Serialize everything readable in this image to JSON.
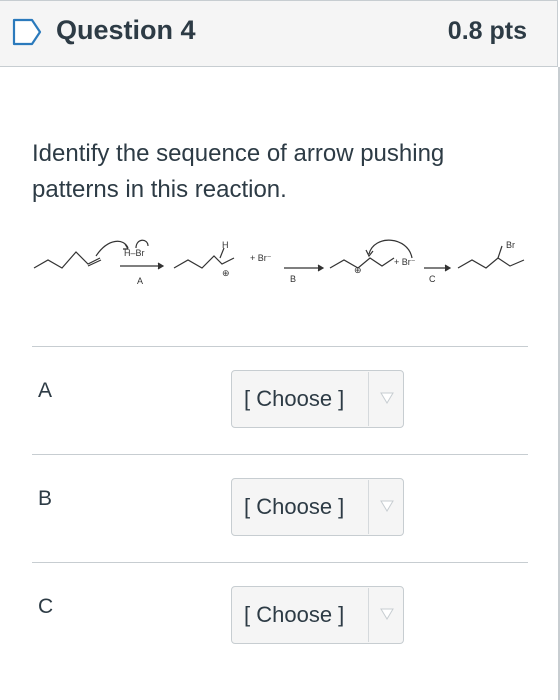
{
  "header": {
    "title": "Question 4",
    "points": "0.8 pts",
    "flag_icon": "bookmark-flag-icon"
  },
  "question": {
    "text": "Identify the sequence of arrow pushing patterns in this reaction."
  },
  "reaction": {
    "reagent": "H–Br",
    "bromide_1": "+ Br⁻",
    "bromide_2": "+ Br⁻",
    "h_label": "H",
    "product_label": "Br",
    "step_labels": [
      "A",
      "B",
      "C"
    ],
    "charge_symbol": "⊕"
  },
  "matches": [
    {
      "label": "A",
      "select_value": "[ Choose ]"
    },
    {
      "label": "B",
      "select_value": "[ Choose ]"
    },
    {
      "label": "C",
      "select_value": "[ Choose ]"
    }
  ],
  "colors": {
    "header_bg": "#f5f5f5",
    "accent_blue": "#2b7abc",
    "text": "#2d3b45",
    "border": "#c7cdd1"
  }
}
